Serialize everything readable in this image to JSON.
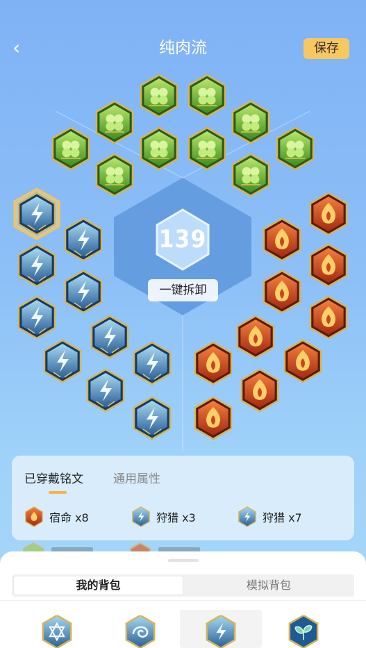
{
  "header": {
    "back_icon": "chevron-left-icon",
    "title": "纯肉流",
    "save_label": "保存"
  },
  "board": {
    "level": "139",
    "unload_label": "一键拆卸",
    "green_rune_icon": "green-clover-rune-icon",
    "blue_rune_icon": "blue-lightning-rune-icon",
    "red_rune_icon": "red-flame-rune-icon",
    "colors": {
      "green": "#6fbd2d",
      "blue": "#2d6fa8",
      "red": "#c8461a",
      "gold": "#e0b04a",
      "highlight": "#f7c35a"
    }
  },
  "panel": {
    "tabs": [
      "已穿戴铭文",
      "通用属性"
    ],
    "active_tab": "已穿戴铭文",
    "stats": [
      {
        "icon": "red-flame-rune-icon",
        "label": "宿命 x8"
      },
      {
        "icon": "blue-lightning-rune-icon",
        "label": "狩猎 x3"
      },
      {
        "icon": "blue-lightning-rune-icon",
        "label": "狩猎 x7"
      }
    ]
  },
  "bottom_sheet": {
    "tabs": [
      "我的背包",
      "模拟背包"
    ],
    "active_tab": "我的背包",
    "bag_items": [
      {
        "icon": "blue-star-rune-icon"
      },
      {
        "icon": "blue-swirl-rune-icon"
      },
      {
        "icon": "blue-lightning-rune-icon",
        "selected": true
      },
      {
        "icon": "blue-sprout-rune-icon"
      }
    ]
  }
}
